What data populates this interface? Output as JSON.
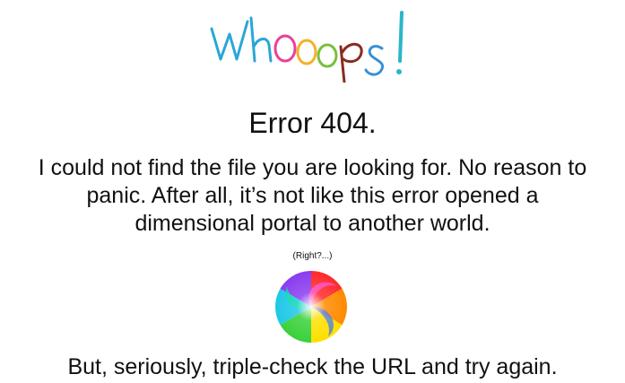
{
  "header": {
    "logo_text": "Whoops!",
    "logo_letter_colors": [
      "#2aa7d6",
      "#2aa7d6",
      "#e9419b",
      "#f4b12a",
      "#7bbf3e",
      "#8a2b20",
      "#3a8fd4",
      "#e9419b",
      "#2ab6c9"
    ]
  },
  "main": {
    "title": "Error 404.",
    "message_lines": [
      "I could not find the file you are looking for. No reason to",
      "panic. After all, it’s not like this error opened a",
      "dimensional portal to another world."
    ],
    "aside": "(Right?...)",
    "portal_icon": "rainbow-swirl-portal"
  },
  "footer": {
    "message": "But, seriously, triple-check the URL and try again."
  }
}
